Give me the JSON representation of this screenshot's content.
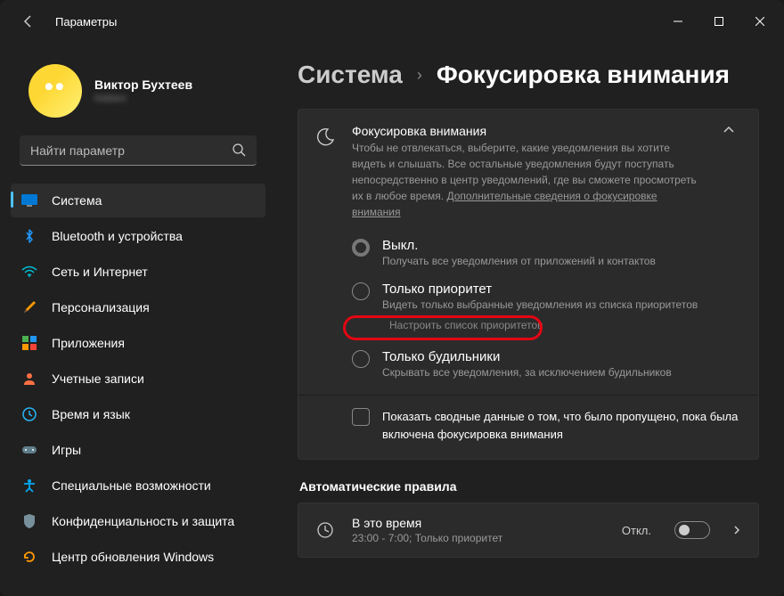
{
  "window": {
    "title": "Параметры"
  },
  "user": {
    "name": "Виктор Бухтеев",
    "email": "hidden"
  },
  "search": {
    "placeholder": "Найти параметр"
  },
  "nav": [
    {
      "label": "Система",
      "icon": "🖥️",
      "active": true
    },
    {
      "label": "Bluetooth и устройства",
      "icon": "bt"
    },
    {
      "label": "Сеть и Интернет",
      "icon": "wifi"
    },
    {
      "label": "Персонализация",
      "icon": "brush"
    },
    {
      "label": "Приложения",
      "icon": "apps"
    },
    {
      "label": "Учетные записи",
      "icon": "user"
    },
    {
      "label": "Время и язык",
      "icon": "clock"
    },
    {
      "label": "Игры",
      "icon": "game"
    },
    {
      "label": "Специальные возможности",
      "icon": "access"
    },
    {
      "label": "Конфиденциальность и защита",
      "icon": "shield"
    },
    {
      "label": "Центр обновления Windows",
      "icon": "update"
    }
  ],
  "breadcrumb": {
    "parent": "Система",
    "current": "Фокусировка внимания"
  },
  "focus": {
    "title": "Фокусировка внимания",
    "description": "Чтобы не отвлекаться, выберите, какие уведомления вы хотите видеть и слышать. Все остальные уведомления будут поступать непосредственно в центр уведомлений, где вы сможете просмотреть их в любое время. ",
    "link": "Дополнительные сведения о фокусировке внимания",
    "options": [
      {
        "title": "Выкл.",
        "desc": "Получать все уведомления от приложений и контактов"
      },
      {
        "title": "Только приоритет",
        "desc": "Видеть только выбранные уведомления из списка приоритетов",
        "sublink": "Настроить список приоритетов"
      },
      {
        "title": "Только будильники",
        "desc": "Скрывать все уведомления, за исключением будильников"
      }
    ],
    "checkbox": "Показать сводные данные о том, что было пропущено, пока была включена фокусировка внимания"
  },
  "rules": {
    "heading": "Автоматические правила",
    "time": {
      "title": "В это время",
      "sub": "23:00 - 7:00; Только приоритет",
      "state": "Откл."
    }
  }
}
